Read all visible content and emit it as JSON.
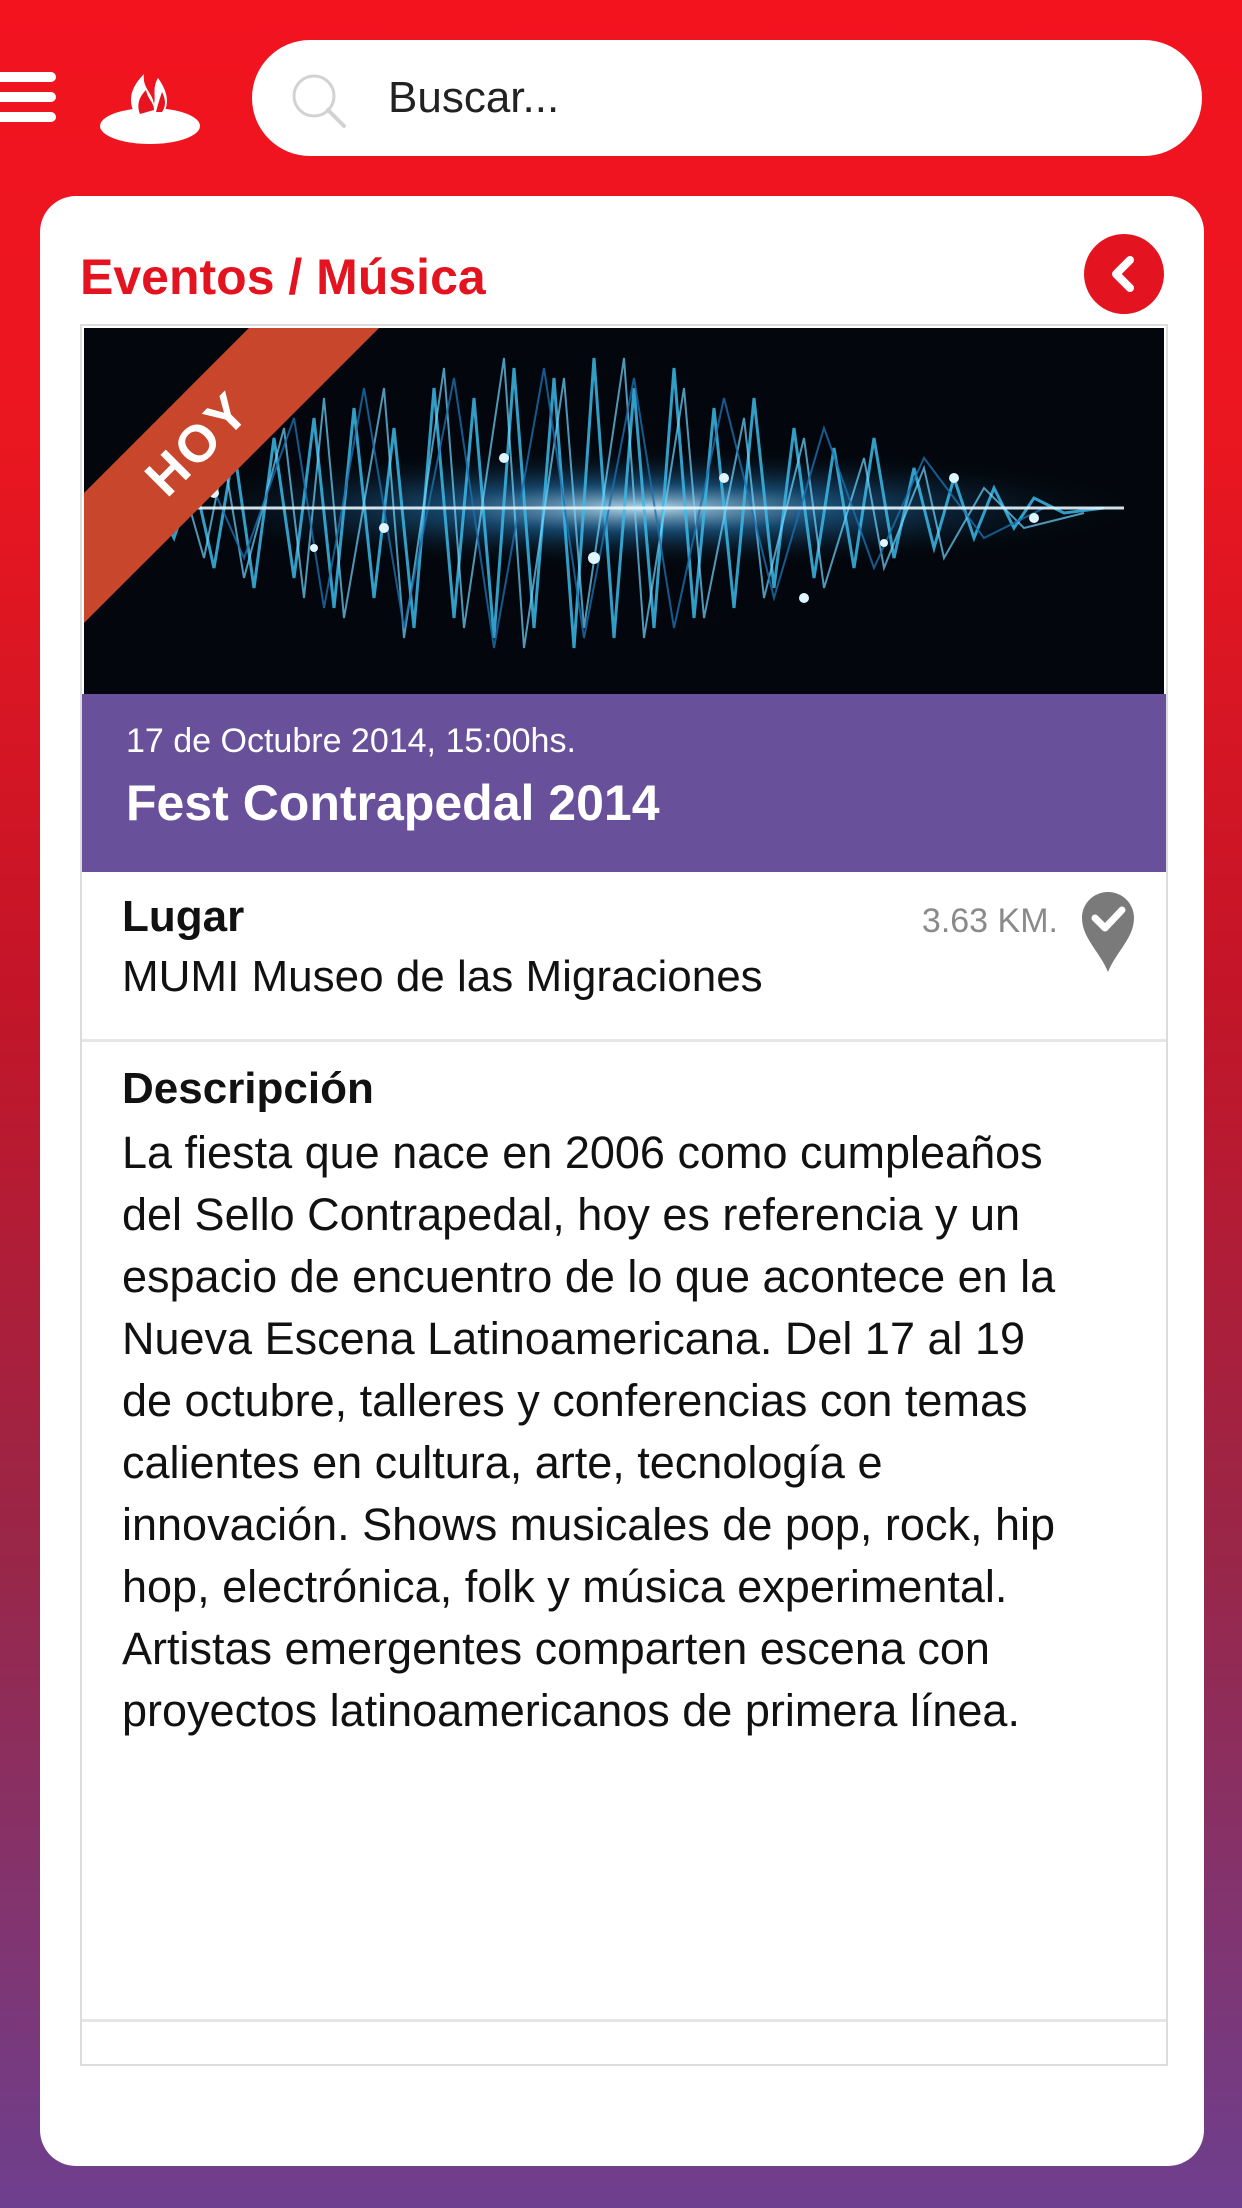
{
  "search": {
    "placeholder": "Buscar..."
  },
  "header": {
    "breadcrumb": "Eventos / Música"
  },
  "event": {
    "badge": "HOY",
    "date": "17 de Octubre 2014, 15:00hs.",
    "title": "Fest Contrapedal 2014",
    "lugar_label": "Lugar",
    "lugar_value": "MUMI Museo de las Migraciones",
    "distance": "3.63 KM.",
    "descripcion_label": "Descripción",
    "descripcion_text": "La fiesta que nace en 2006 como cumpleaños del Sello Contrapedal, hoy es referencia y un espacio de encuentro de lo que acontece en la Nueva Escena Latinoamericana. Del 17 al 19 de octubre, talleres y conferencias con temas calientes en cultura, arte, tecnología e innovación. Shows musicales de pop, rock, hip hop, electrónica, folk y música experimental. Artistas emergentes comparten escena con proyectos latinoamericanos de primera línea."
  },
  "colors": {
    "brand_red": "#e3141f",
    "event_band": "#68509a",
    "ribbon": "#c7462c"
  },
  "icons": [
    "menu-icon",
    "santander-flame-logo",
    "search-icon",
    "back-chevron-icon",
    "location-pin-check-icon"
  ]
}
